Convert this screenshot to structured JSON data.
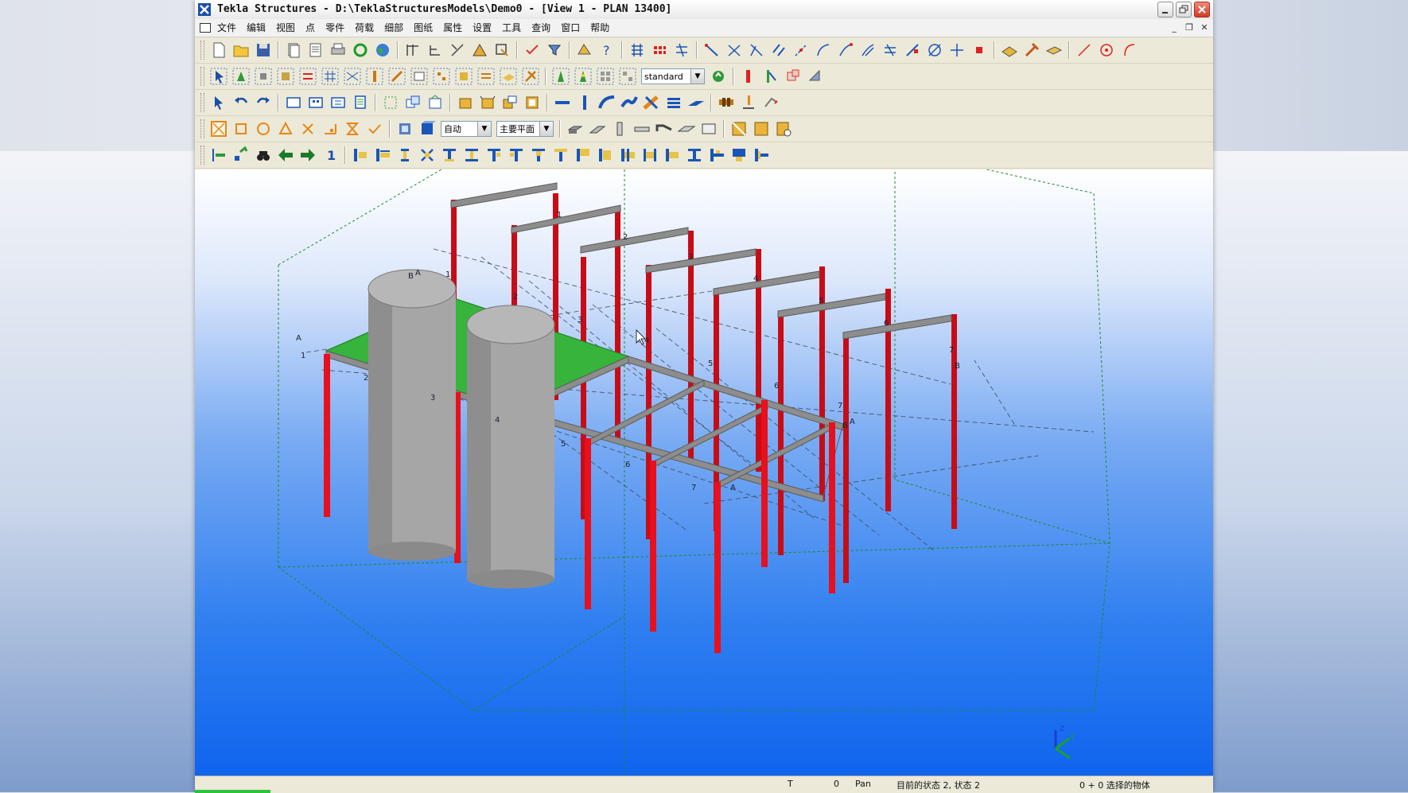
{
  "window": {
    "title": "Tekla Structures - D:\\TeklaStructuresModels\\Demo0 - [View 1 - PLAN 13400]",
    "controls": [
      "minimize",
      "restore",
      "close"
    ]
  },
  "menu": {
    "items": [
      "文件",
      "编辑",
      "视图",
      "点",
      "零件",
      "荷载",
      "细部",
      "图纸",
      "属性",
      "设置",
      "工具",
      "查询",
      "窗口",
      "帮助"
    ],
    "mdi_controls": [
      "_",
      "❐",
      "✕"
    ]
  },
  "toolbars": {
    "combo_standard": "standard",
    "combo_auto": "自动",
    "combo_plane": "主要平面",
    "label_one": "1"
  },
  "viewport": {
    "grid_labels": {
      "left_A": "A",
      "left_1": "1",
      "top_B": "B",
      "top_A": "A",
      "right_7": "7",
      "right_B": "B",
      "mid_A": "A",
      "mid_B": "B",
      "front_A": "A"
    },
    "numbers": {
      "top": [
        "1",
        "2",
        "3",
        "4",
        "5",
        "6"
      ],
      "back": [
        "1",
        "2",
        "3",
        "4",
        "5",
        "6",
        "7"
      ],
      "front": [
        "2",
        "3",
        "4",
        "5",
        "6",
        "7"
      ]
    },
    "axis": {
      "z": "Z",
      "y": "Y",
      "x": "X"
    }
  },
  "colors": {
    "column": "#e8101c",
    "beam": "#8b8b8b",
    "slab": "#36b43c",
    "tank": "#a6a6a6",
    "background_top": "#ffffff",
    "background_bottom": "#1064ee"
  },
  "status": {
    "t_label": "T",
    "zero": "0",
    "mode": "Pan",
    "state": "目前的状态 2, 状态 2",
    "selection": "0 + 0 选择的物体"
  }
}
